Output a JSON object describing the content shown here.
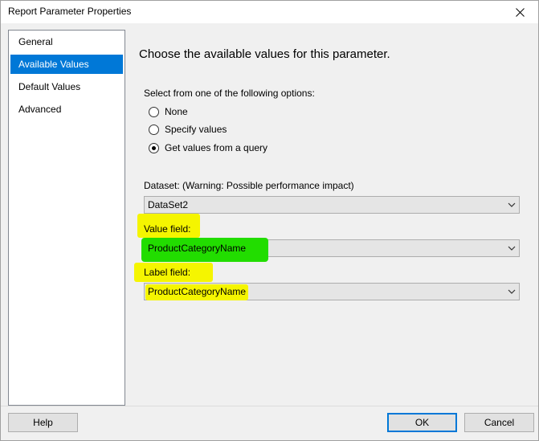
{
  "window": {
    "title": "Report Parameter Properties"
  },
  "nav": {
    "items": [
      "General",
      "Available Values",
      "Default Values",
      "Advanced"
    ],
    "active_index": 1
  },
  "main": {
    "heading": "Choose the available values for this parameter.",
    "options_label": "Select from one of the following options:",
    "options": [
      "None",
      "Specify values",
      "Get values from a query"
    ],
    "selected_option_index": 2,
    "dataset_label": "Dataset: (Warning: Possible performance impact)",
    "dataset_value": "DataSet2",
    "value_field_label": "Value field:",
    "value_field_value": "ProductCategoryName",
    "label_field_label": "Label field:",
    "label_field_value": "ProductCategoryName"
  },
  "footer": {
    "help": "Help",
    "ok": "OK",
    "cancel": "Cancel"
  },
  "colors": {
    "selection_blue": "#0078d7",
    "highlight_yellow": "#f5f500",
    "highlight_green": "#22dd00"
  },
  "icons": {
    "close": "close-icon",
    "dropdown": "chevron-down-icon"
  }
}
